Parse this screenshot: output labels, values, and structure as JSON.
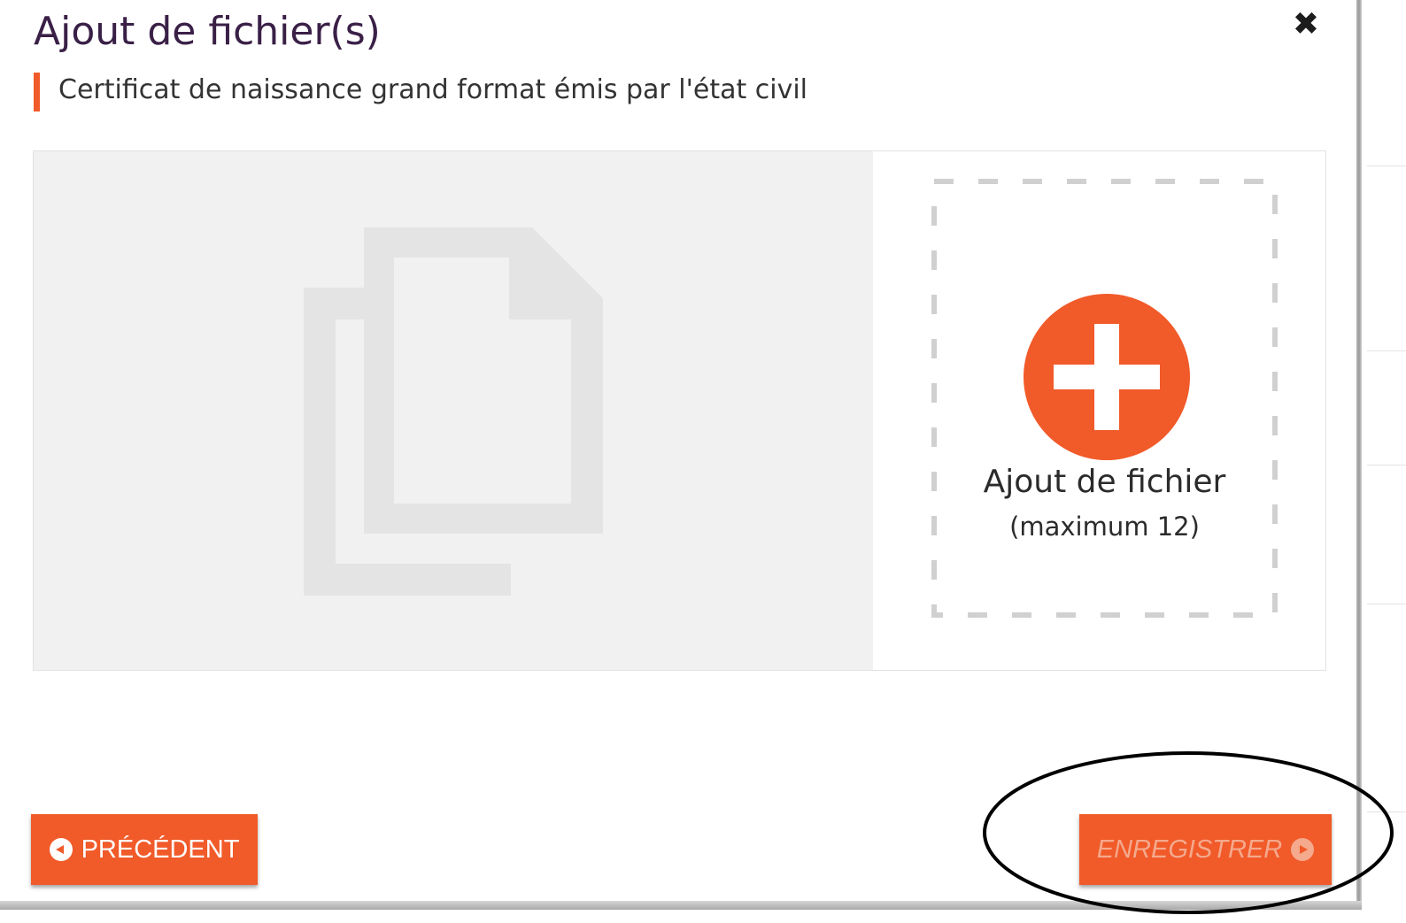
{
  "modal": {
    "title": "Ajout de fichier(s)",
    "close_icon": "close-icon",
    "subtitle": "Certificat de naissance grand format émis par l'état civil"
  },
  "upload": {
    "preview_icon": "files-icon",
    "dropzone_icon": "plus-icon",
    "dropzone_label": "Ajout de fichier",
    "dropzone_limit": "(maximum 12)"
  },
  "footer": {
    "prev_label": "PRÉCÉDENT",
    "prev_icon": "arrow-left-circle-icon",
    "save_label": "ENREGISTRER",
    "save_icon": "arrow-right-circle-icon",
    "save_state": "disabled"
  },
  "colors": {
    "accent": "#f15a29",
    "title": "#3a2047",
    "disabled_text": "#f5a98d",
    "preview_bg": "#f1f1f1"
  }
}
